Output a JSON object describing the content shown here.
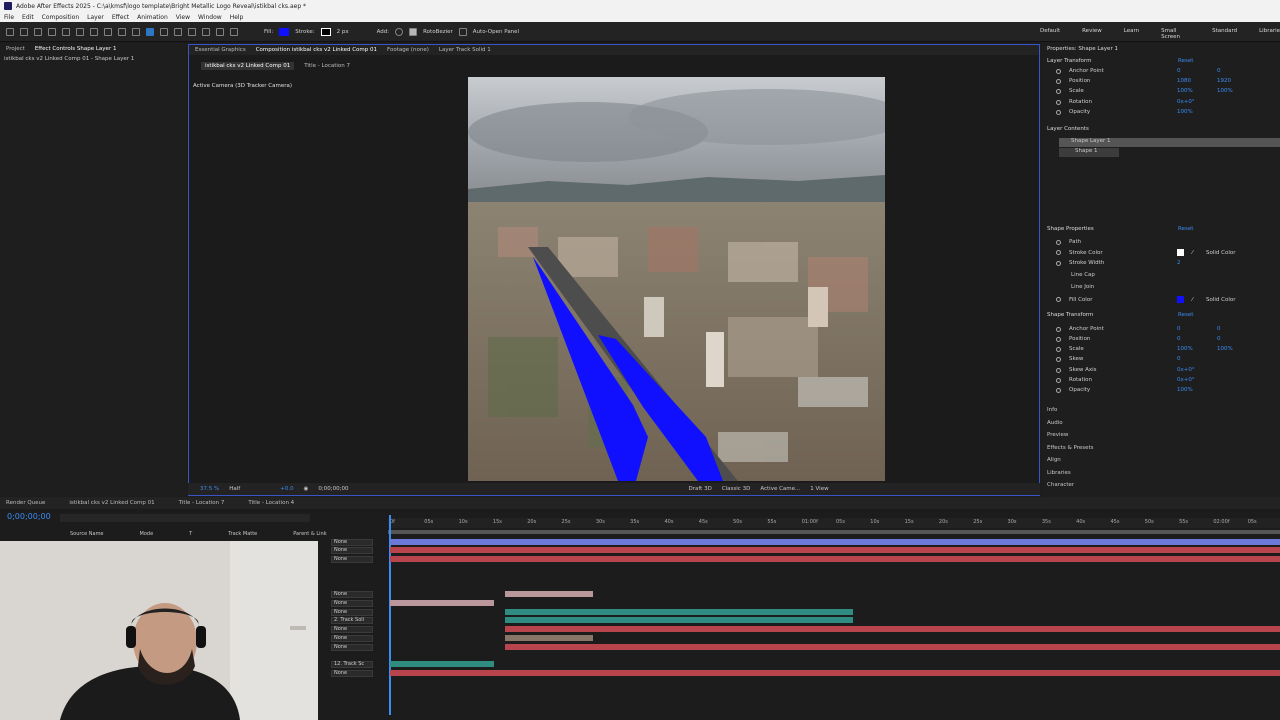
{
  "app": {
    "title": "Adobe After Effects 2025 - C:\\a\\kmsf\\logo template\\Bright Metallic Logo Reveal\\istikbal cks.aep *"
  },
  "menu": [
    "File",
    "Edit",
    "Composition",
    "Layer",
    "Effect",
    "Animation",
    "View",
    "Window",
    "Help"
  ],
  "toolbar": {
    "fill_label": "Fill:",
    "stroke_label": "Stroke:",
    "stroke_px": "2 px",
    "add_label": "Add:",
    "roto_bezier": "RotoBezier",
    "auto_open": "Auto-Open Panel"
  },
  "workspaces": [
    "Default",
    "Review",
    "Learn",
    "Small Screen",
    "Standard",
    "Librarie"
  ],
  "left_panel": {
    "tabs": [
      "Project",
      "Effect Controls Shape Layer 1"
    ],
    "subtitle": "istikbal cks v2 Linked Comp 01 - Shape Layer 1"
  },
  "viewer": {
    "tabs": [
      "Essential Graphics",
      "Composition istikbal cks v2 Linked Comp 01",
      "Footage (none)",
      "Layer Track Solid 1"
    ],
    "subtabs": [
      "istikbal cks v2 Linked Comp 01",
      "Title - Location 7"
    ],
    "camera_label": "Active Camera (3D Tracker Camera)",
    "zoom": "37.5 %",
    "resolution": "Half",
    "exposure": "+0.0",
    "timecode": "0;00;00;00",
    "renderer": "Draft 3D",
    "classic": "Classic 3D",
    "camera": "Active Came...",
    "views": "1 View"
  },
  "properties": {
    "title": "Properties: Shape Layer 1",
    "layer_transform": "Layer Transform",
    "reset": "Reset",
    "rows": [
      {
        "label": "Anchor Point",
        "v1": "0",
        "v2": "0"
      },
      {
        "label": "Position",
        "v1": "1080",
        "v2": "1920"
      },
      {
        "label": "Scale",
        "v1": "100%",
        "v2": "100%"
      },
      {
        "label": "Rotation",
        "v1": "0x+0°",
        "v2": ""
      },
      {
        "label": "Opacity",
        "v1": "100%",
        "v2": ""
      }
    ],
    "layer_contents": "Layer Contents",
    "contents": [
      "Shape Layer 1",
      "Shape 1"
    ],
    "shape_properties": "Shape Properties",
    "shape_rows": [
      {
        "label": "Path",
        "v1": ""
      },
      {
        "label": "Stroke Color",
        "v1": "Solid Color"
      },
      {
        "label": "Stroke Width",
        "v1": "2"
      },
      {
        "label": "Line Cap",
        "v1": ""
      },
      {
        "label": "Line Join",
        "v1": ""
      },
      {
        "label": "Fill Color",
        "v1": "Solid Color"
      }
    ],
    "shape_transform": "Shape Transform",
    "shape_transform_rows": [
      {
        "label": "Anchor Point",
        "v1": "0",
        "v2": "0"
      },
      {
        "label": "Position",
        "v1": "0",
        "v2": "0"
      },
      {
        "label": "Scale",
        "v1": "100%",
        "v2": "100%"
      },
      {
        "label": "Skew",
        "v1": "0",
        "v2": ""
      },
      {
        "label": "Skew Axis",
        "v1": "0x+0°",
        "v2": ""
      },
      {
        "label": "Rotation",
        "v1": "0x+0°",
        "v2": ""
      },
      {
        "label": "Opacity",
        "v1": "100%",
        "v2": ""
      }
    ],
    "panels": [
      "Info",
      "Audio",
      "Preview",
      "Effects & Presets",
      "Align",
      "Libraries",
      "Character"
    ]
  },
  "timeline": {
    "tabs": [
      "Render Queue",
      "istikbal cks v2 Linked Comp 01",
      "Title - Location 7",
      "Title - Location 4"
    ],
    "timecode": "0;00;00;00",
    "columns": [
      "Source Name",
      "Mode",
      "T",
      "Track Matte",
      "Parent & Link"
    ],
    "ruler": [
      "0f",
      "05s",
      "10s",
      "15s",
      "20s",
      "25s",
      "30s",
      "35s",
      "40s",
      "45s",
      "50s",
      "55s",
      "01:00f",
      "05s",
      "10s",
      "15s",
      "20s",
      "25s",
      "30s",
      "35s",
      "40s",
      "45s",
      "50s",
      "55s",
      "02:00f",
      "05s"
    ],
    "parents": [
      "None",
      "None",
      "None",
      "None",
      "None",
      "None",
      "2. Track Soli",
      "None",
      "None",
      "None",
      "12. Track Sc",
      "None"
    ]
  },
  "colors": {
    "accent": "#2d8ceb",
    "viewer_border": "#3a55c8",
    "fill_blue": "#1010ff",
    "track_red": "#b8444d",
    "track_teal": "#2e8c80",
    "track_purple": "#6c79d8"
  }
}
